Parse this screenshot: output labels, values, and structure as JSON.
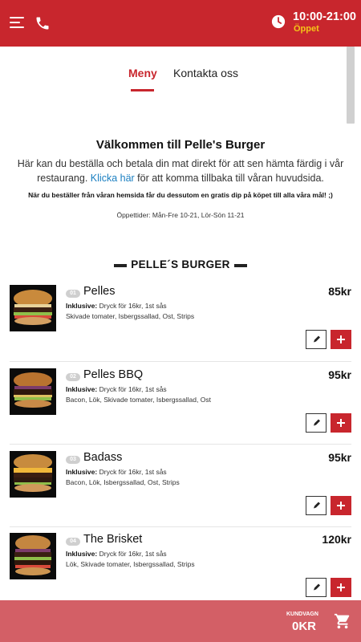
{
  "header": {
    "hours": "10:00-21:00",
    "status": "Öppet",
    "icons": [
      "menu-icon",
      "phone-icon",
      "clock-icon"
    ],
    "colors": {
      "brand": "#c8262d",
      "status": "#f5c518"
    }
  },
  "tabs": [
    {
      "label": "Meny",
      "active": true
    },
    {
      "label": "Kontakta oss",
      "active": false
    }
  ],
  "welcome": {
    "title": "Välkommen till Pelle's Burger",
    "text_before": "Här kan du beställa och betala din mat direkt för att sen hämta färdig i vår restaurang. ",
    "link_text": "Klicka här",
    "text_after": " för att komma tillbaka till våran huvudsida.",
    "dip_note": "När du beställer från våran hemsida får du dessutom en gratis dip på köpet till alla våra mål! ;)",
    "opening_hours": "Öppettider: Mån-Fre 10-21, Lör-Sön 11-21"
  },
  "section_title": "PELLE´S BURGER",
  "inclusive_label": "Inklusive:",
  "items": [
    {
      "number": "01",
      "name": "Pelles",
      "price": "85kr",
      "inclusive": "Dryck för 16kr, 1st sås",
      "ingredients": "Skivade tomater, Isbergssallad, Ost, Strips"
    },
    {
      "number": "02",
      "name": "Pelles BBQ",
      "price": "95kr",
      "inclusive": "Dryck för 16kr, 1st sås",
      "ingredients": "Bacon, Lök, Skivade tomater, Isbergssallad, Ost"
    },
    {
      "number": "03",
      "name": "Badass",
      "price": "95kr",
      "inclusive": "Dryck för 16kr, 1st sås",
      "ingredients": "Bacon, Lök, Isbergssallad, Ost, Strips"
    },
    {
      "number": "04",
      "name": "The Brisket",
      "price": "120kr",
      "inclusive": "Dryck för 16kr, 1st sås",
      "ingredients": "Lök, Skivade tomater, Isbergssallad, Strips"
    }
  ],
  "cart": {
    "label": "KUNDVAGN",
    "total": "0KR",
    "icon": "cart-icon"
  }
}
